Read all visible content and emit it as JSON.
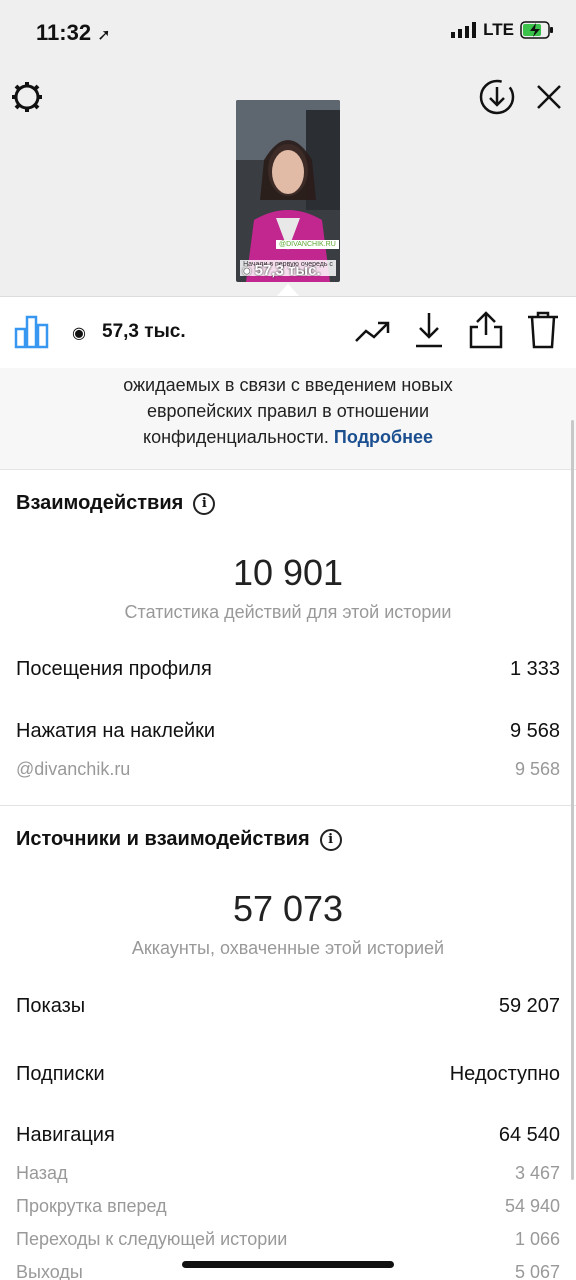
{
  "status_bar": {
    "time": "11:32",
    "network": "LTE"
  },
  "story": {
    "thumbnail_caption": "Начали в первую очередь с",
    "thumbnail_tag": "@DIVANCHIK.RU",
    "thumbnail_views": "57,3 тыс."
  },
  "toolbar": {
    "views": "57,3 тыс."
  },
  "notice": {
    "line_top": "",
    "line1": "ожидаемых в связи с введением новых",
    "line2": "европейских правил в отношении",
    "line3": "конфиденциальности.",
    "link": "Подробнее"
  },
  "interactions": {
    "title": "Взаимодействия",
    "total": "10 901",
    "subtitle": "Статистика действий для этой истории",
    "rows": [
      {
        "label": "Посещения профиля",
        "value": "1 333"
      },
      {
        "label": "Нажатия на наклейки",
        "value": "9 568"
      }
    ],
    "sub_rows": [
      {
        "label": "@divanchik.ru",
        "value": "9 568"
      }
    ]
  },
  "sources": {
    "title": "Источники и взаимодействия",
    "total": "57 073",
    "subtitle": "Аккаунты, охваченные этой историей",
    "rows": [
      {
        "label": "Показы",
        "value": "59 207"
      },
      {
        "label": "Подписки",
        "value": "Недоступно"
      },
      {
        "label": "Навигация",
        "value": "64 540"
      }
    ],
    "sub_rows": [
      {
        "label": "Назад",
        "value": "3 467"
      },
      {
        "label": "Прокрутка вперед",
        "value": "54 940"
      },
      {
        "label": "Переходы к следующей истории",
        "value": "1 066"
      },
      {
        "label": "Выходы",
        "value": "5 067"
      }
    ]
  },
  "colors": {
    "accent": "#3897f0",
    "link": "#1b4f8f",
    "muted": "#999999"
  }
}
